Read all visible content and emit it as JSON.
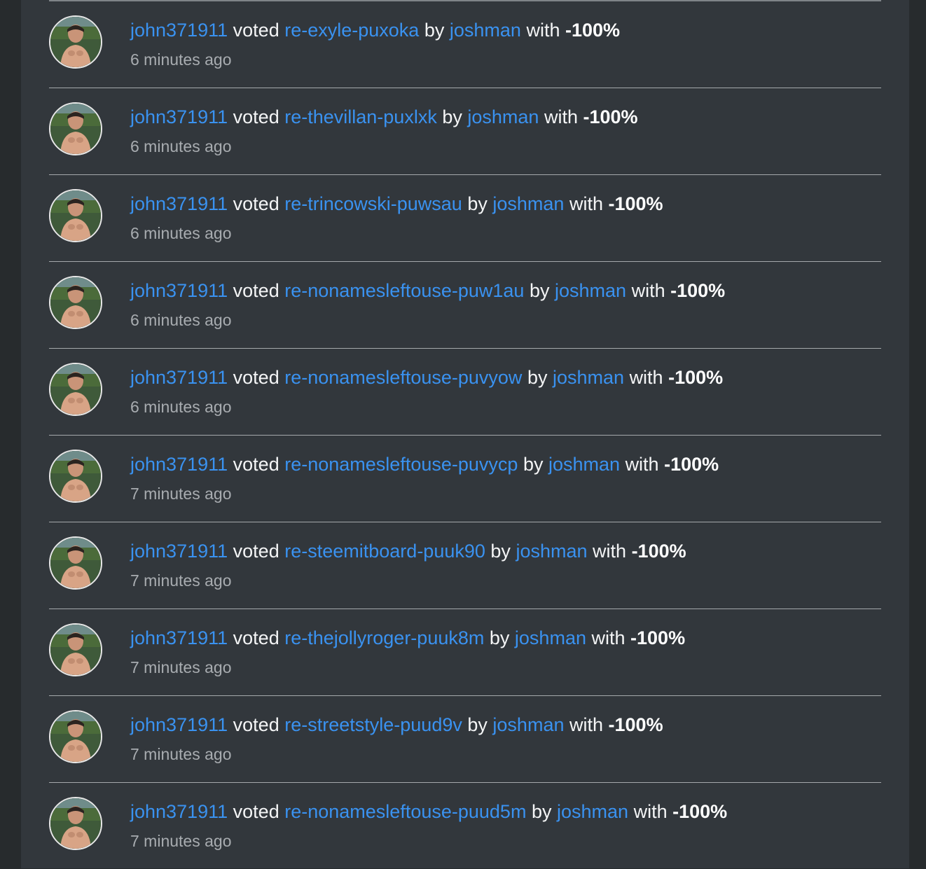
{
  "feed": {
    "items": [
      {
        "user": "john371911",
        "verb": "voted",
        "post": "re-exyle-puxoka",
        "by_word": "by",
        "author": "joshman",
        "with_word": "with",
        "weight": "-100%",
        "time": "6 minutes ago"
      },
      {
        "user": "john371911",
        "verb": "voted",
        "post": "re-thevillan-puxlxk",
        "by_word": "by",
        "author": "joshman",
        "with_word": "with",
        "weight": "-100%",
        "time": "6 minutes ago"
      },
      {
        "user": "john371911",
        "verb": "voted",
        "post": "re-trincowski-puwsau",
        "by_word": "by",
        "author": "joshman",
        "with_word": "with",
        "weight": "-100%",
        "time": "6 minutes ago"
      },
      {
        "user": "john371911",
        "verb": "voted",
        "post": "re-nonamesleftouse-puw1au",
        "by_word": "by",
        "author": "joshman",
        "with_word": "with",
        "weight": "-100%",
        "time": "6 minutes ago"
      },
      {
        "user": "john371911",
        "verb": "voted",
        "post": "re-nonamesleftouse-puvyow",
        "by_word": "by",
        "author": "joshman",
        "with_word": "with",
        "weight": "-100%",
        "time": "6 minutes ago"
      },
      {
        "user": "john371911",
        "verb": "voted",
        "post": "re-nonamesleftouse-puvycp",
        "by_word": "by",
        "author": "joshman",
        "with_word": "with",
        "weight": "-100%",
        "time": "7 minutes ago"
      },
      {
        "user": "john371911",
        "verb": "voted",
        "post": "re-steemitboard-puuk90",
        "by_word": "by",
        "author": "joshman",
        "with_word": "with",
        "weight": "-100%",
        "time": "7 minutes ago"
      },
      {
        "user": "john371911",
        "verb": "voted",
        "post": "re-thejollyroger-puuk8m",
        "by_word": "by",
        "author": "joshman",
        "with_word": "with",
        "weight": "-100%",
        "time": "7 minutes ago"
      },
      {
        "user": "john371911",
        "verb": "voted",
        "post": "re-streetstyle-puud9v",
        "by_word": "by",
        "author": "joshman",
        "with_word": "with",
        "weight": "-100%",
        "time": "7 minutes ago"
      },
      {
        "user": "john371911",
        "verb": "voted",
        "post": "re-nonamesleftouse-puud5m",
        "by_word": "by",
        "author": "joshman",
        "with_word": "with",
        "weight": "-100%",
        "time": "7 minutes ago"
      }
    ]
  },
  "colors": {
    "page_bg": "#272b2d",
    "panel_bg": "#32373c",
    "link": "#3a92f0",
    "text": "#f4f5f6",
    "muted": "#a8acb0"
  },
  "icons": {
    "avatar": "user-avatar-photo"
  }
}
